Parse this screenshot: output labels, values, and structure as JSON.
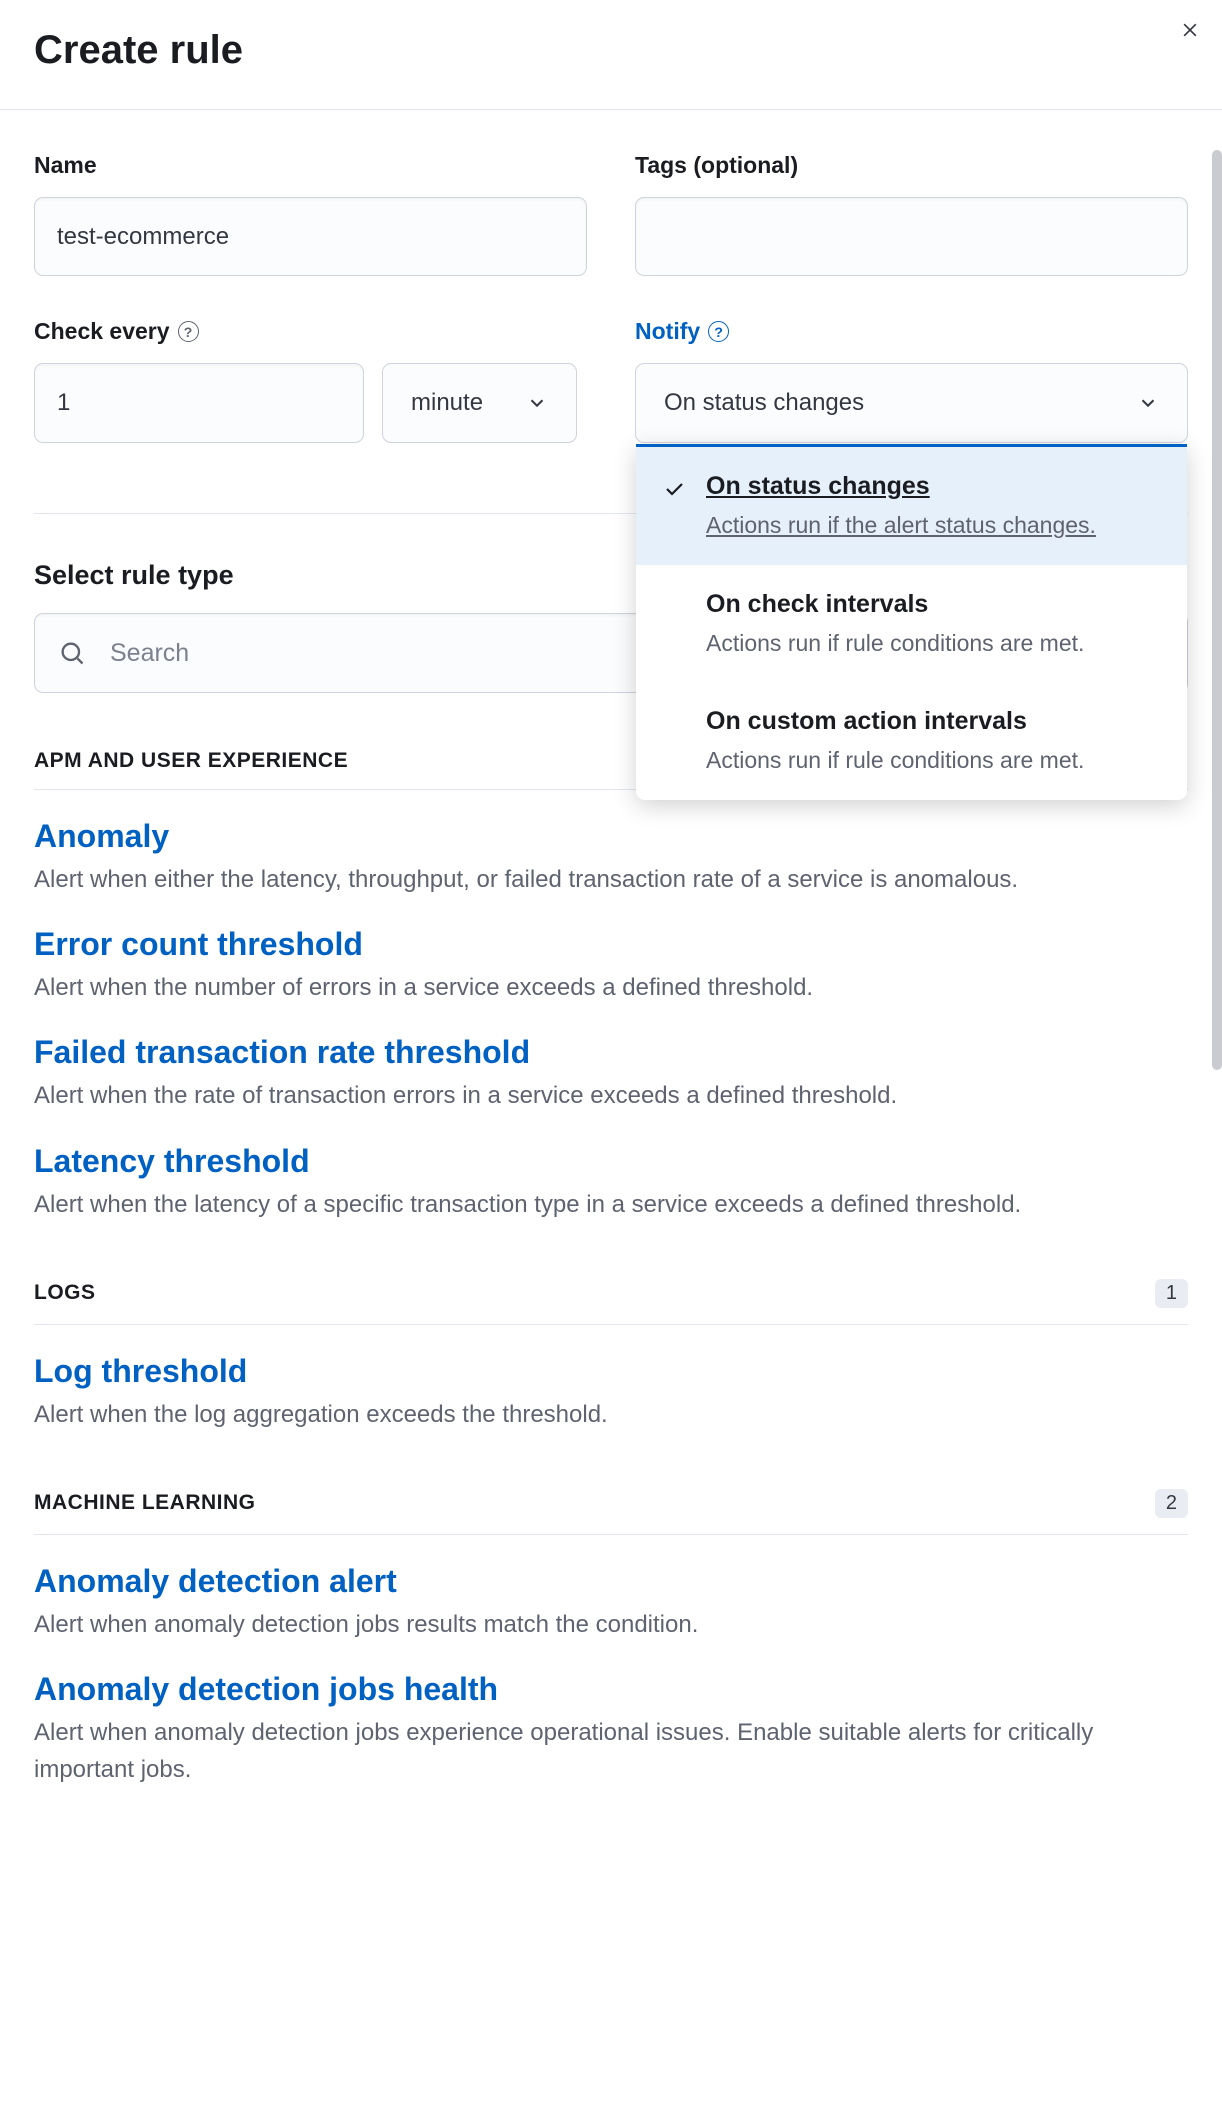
{
  "header": {
    "title": "Create rule"
  },
  "form": {
    "name": {
      "label": "Name",
      "value": "test-ecommerce"
    },
    "tags": {
      "label": "Tags (optional)",
      "value": ""
    },
    "checkEvery": {
      "label": "Check every",
      "value": "1",
      "unit": "minute"
    },
    "notify": {
      "label": "Notify",
      "selected": "On status changes",
      "options": [
        {
          "title": "On status changes",
          "desc": "Actions run if the alert status changes.",
          "selected": true
        },
        {
          "title": "On check intervals",
          "desc": "Actions run if rule conditions are met.",
          "selected": false
        },
        {
          "title": "On custom action intervals",
          "desc": "Actions run if rule conditions are met.",
          "selected": false
        }
      ]
    }
  },
  "ruleTypes": {
    "title": "Select rule type",
    "searchPlaceholder": "Search",
    "categories": [
      {
        "name": "APM AND USER EXPERIENCE",
        "badge": "",
        "rules": [
          {
            "title": "Anomaly",
            "desc": "Alert when either the latency, throughput, or failed transaction rate of a service is anomalous."
          },
          {
            "title": "Error count threshold",
            "desc": "Alert when the number of errors in a service exceeds a defined threshold."
          },
          {
            "title": "Failed transaction rate threshold",
            "desc": "Alert when the rate of transaction errors in a service exceeds a defined threshold."
          },
          {
            "title": "Latency threshold",
            "desc": "Alert when the latency of a specific transaction type in a service exceeds a defined threshold."
          }
        ]
      },
      {
        "name": "LOGS",
        "badge": "1",
        "rules": [
          {
            "title": "Log threshold",
            "desc": "Alert when the log aggregation exceeds the threshold."
          }
        ]
      },
      {
        "name": "MACHINE LEARNING",
        "badge": "2",
        "rules": [
          {
            "title": "Anomaly detection alert",
            "desc": "Alert when anomaly detection jobs results match the condition."
          },
          {
            "title": "Anomaly detection jobs health",
            "desc": "Alert when anomaly detection jobs experience operational issues. Enable suitable alerts for critically important jobs."
          }
        ]
      }
    ]
  }
}
